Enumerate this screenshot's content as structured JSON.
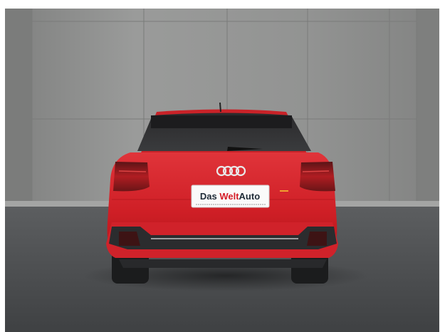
{
  "photo": {
    "subject": "car-rear-view",
    "car_color": "#d8262b",
    "wall_color": "#8e8f8e",
    "floor_color": "#4c4e50",
    "brand_logo": "four-rings-logo",
    "license_plate": {
      "text_dark": "Das ",
      "text_red": "Welt",
      "text_dark_2": "Auto",
      "red_color": "#d51b26",
      "dark_color": "#1e2b37"
    }
  }
}
